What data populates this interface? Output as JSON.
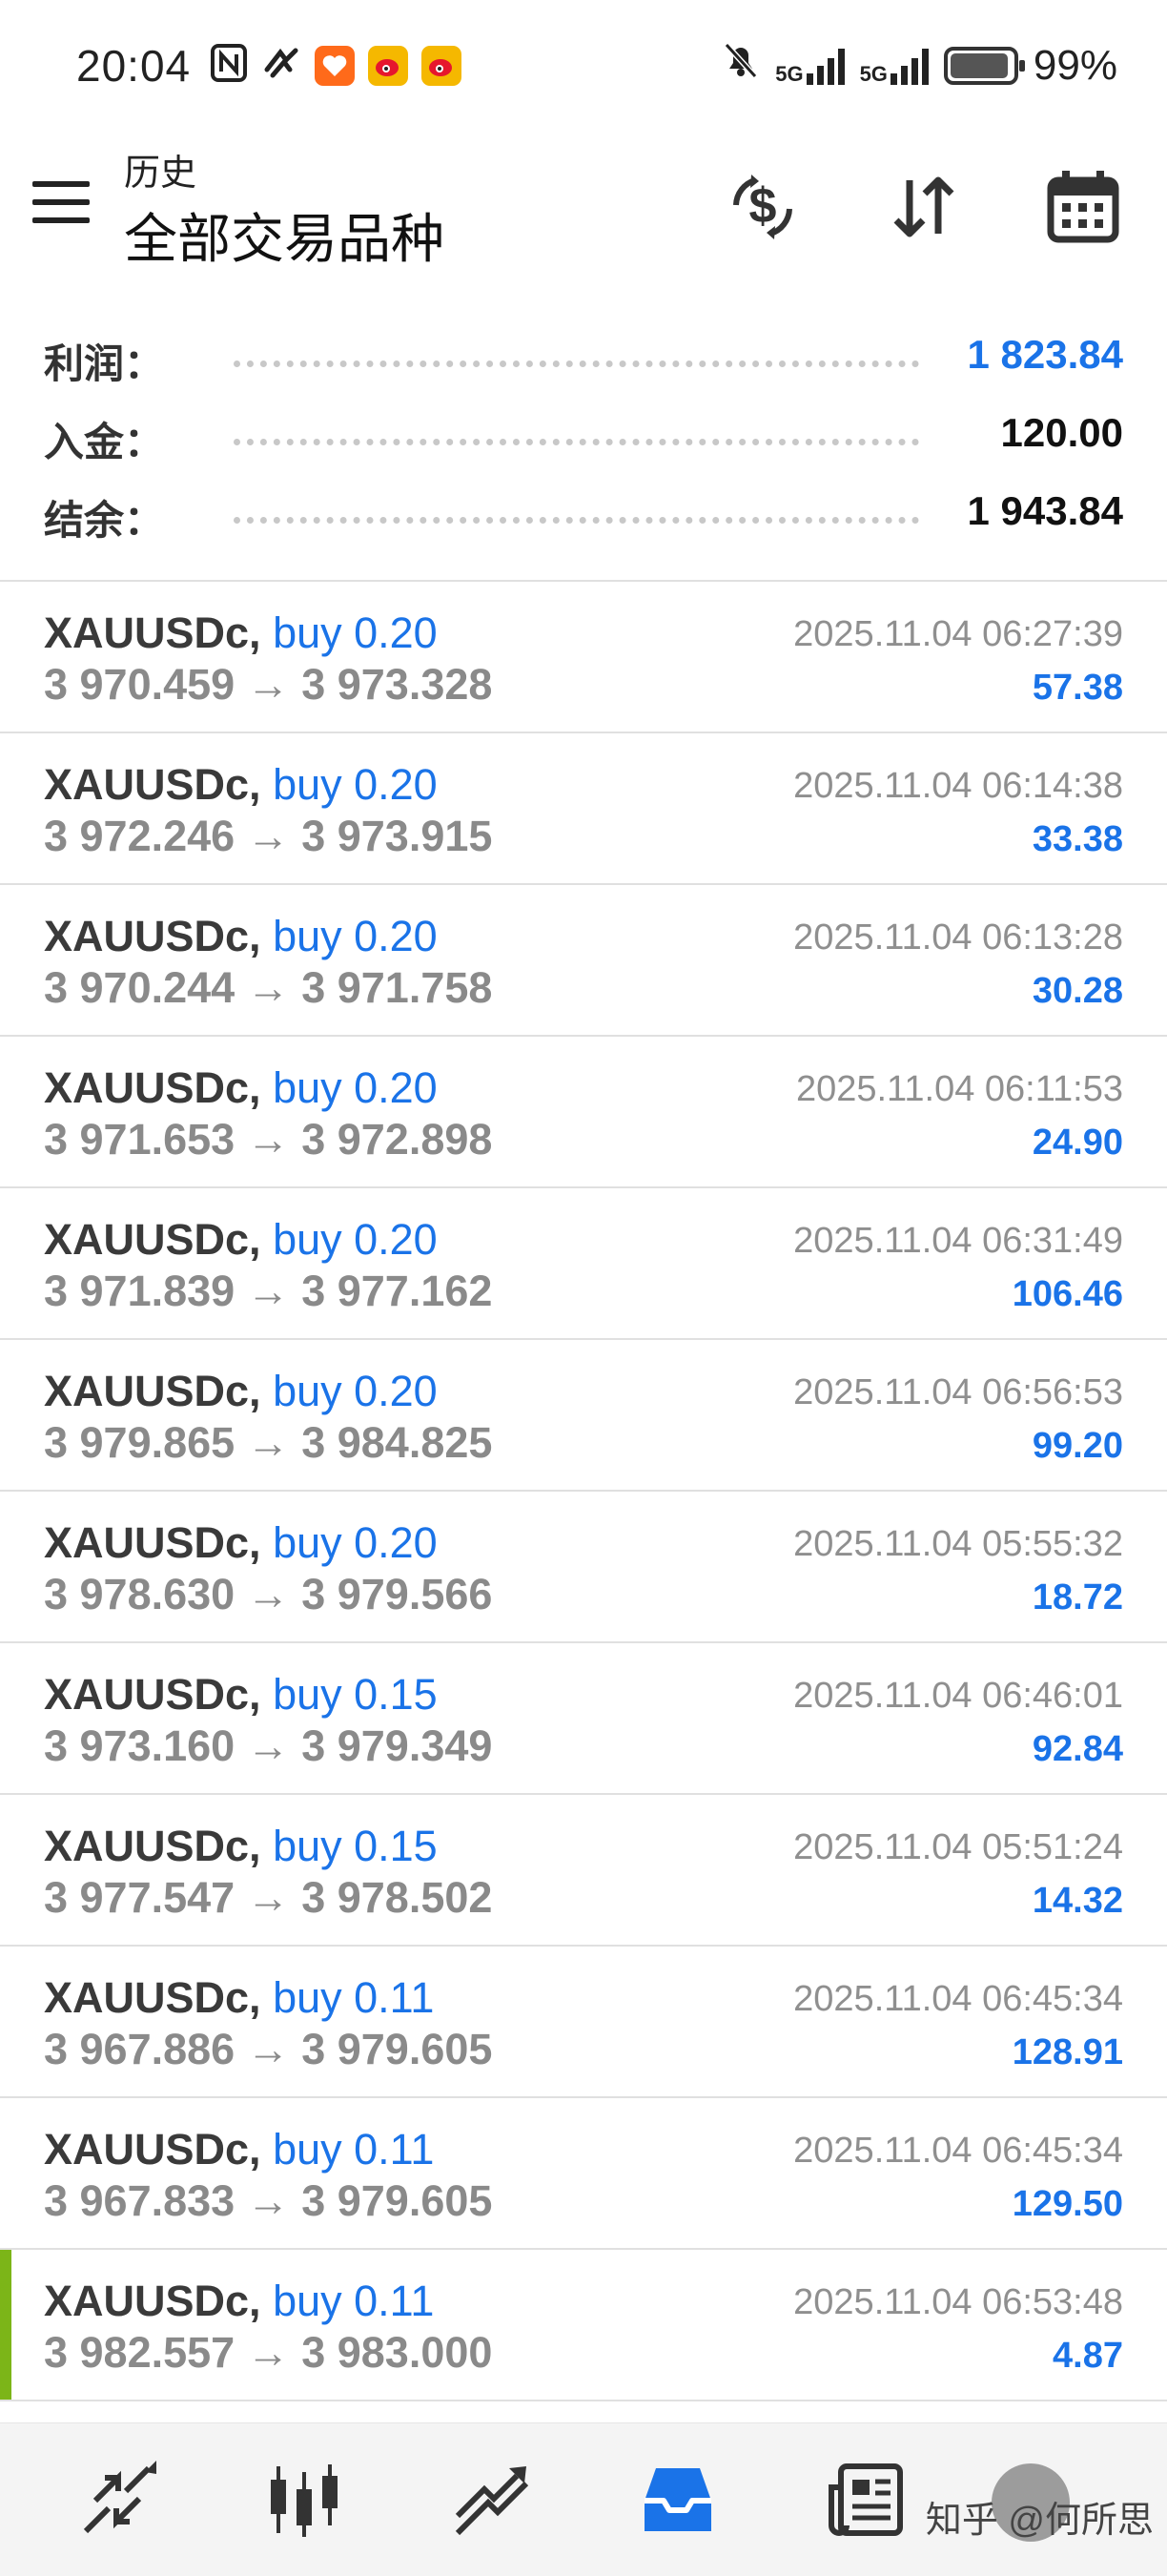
{
  "status_bar": {
    "time": "20:04",
    "battery": "99%",
    "network_1": "5G",
    "network_2": "5G",
    "left_icons": [
      "nfc-icon",
      "swirl-icon",
      "heart-app-icon",
      "weibo-icon",
      "weibo-icon"
    ],
    "right_icons": [
      "mute-bell-icon",
      "signal-icon",
      "signal-icon",
      "battery-icon"
    ]
  },
  "header": {
    "subtitle": "历史",
    "title": "全部交易品种",
    "actions": [
      "currency-exchange-icon",
      "sort-icon",
      "calendar-icon"
    ]
  },
  "summary": {
    "profit_label": "利润：",
    "profit_value": "1 823.84",
    "deposit_label": "入金：",
    "deposit_value": "120.00",
    "balance_label": "结余：",
    "balance_value": "1 943.84"
  },
  "trades": [
    {
      "symbol": "XAUUSDc",
      "side": "buy 0.20",
      "open": "3 970.459",
      "close": "3 973.328",
      "time": "2025.11.04 06:27:39",
      "profit": "57.38"
    },
    {
      "symbol": "XAUUSDc",
      "side": "buy 0.20",
      "open": "3 972.246",
      "close": "3 973.915",
      "time": "2025.11.04 06:14:38",
      "profit": "33.38"
    },
    {
      "symbol": "XAUUSDc",
      "side": "buy 0.20",
      "open": "3 970.244",
      "close": "3 971.758",
      "time": "2025.11.04 06:13:28",
      "profit": "30.28"
    },
    {
      "symbol": "XAUUSDc",
      "side": "buy 0.20",
      "open": "3 971.653",
      "close": "3 972.898",
      "time": "2025.11.04 06:11:53",
      "profit": "24.90"
    },
    {
      "symbol": "XAUUSDc",
      "side": "buy 0.20",
      "open": "3 971.839",
      "close": "3 977.162",
      "time": "2025.11.04 06:31:49",
      "profit": "106.46"
    },
    {
      "symbol": "XAUUSDc",
      "side": "buy 0.20",
      "open": "3 979.865",
      "close": "3 984.825",
      "time": "2025.11.04 06:56:53",
      "profit": "99.20"
    },
    {
      "symbol": "XAUUSDc",
      "side": "buy 0.20",
      "open": "3 978.630",
      "close": "3 979.566",
      "time": "2025.11.04 05:55:32",
      "profit": "18.72"
    },
    {
      "symbol": "XAUUSDc",
      "side": "buy 0.15",
      "open": "3 973.160",
      "close": "3 979.349",
      "time": "2025.11.04 06:46:01",
      "profit": "92.84"
    },
    {
      "symbol": "XAUUSDc",
      "side": "buy 0.15",
      "open": "3 977.547",
      "close": "3 978.502",
      "time": "2025.11.04 05:51:24",
      "profit": "14.32"
    },
    {
      "symbol": "XAUUSDc",
      "side": "buy 0.11",
      "open": "3 967.886",
      "close": "3 979.605",
      "time": "2025.11.04 06:45:34",
      "profit": "128.91"
    },
    {
      "symbol": "XAUUSDc",
      "side": "buy 0.11",
      "open": "3 967.833",
      "close": "3 979.605",
      "time": "2025.11.04 06:45:34",
      "profit": "129.50"
    },
    {
      "symbol": "XAUUSDc",
      "side": "buy 0.11",
      "open": "3 982.557",
      "close": "3 983.000",
      "time": "2025.11.04 06:53:48",
      "profit": "4.87"
    }
  ],
  "bottom_nav": {
    "items": [
      "quotes-icon",
      "chart-icon",
      "trade-icon",
      "history-icon",
      "news-icon",
      "avatar"
    ],
    "active": "history-icon",
    "watermark": "知乎 @何所思"
  },
  "colors": {
    "accent": "#1a73e8",
    "marker": "#7cb518",
    "divider": "#e0e0e0"
  }
}
